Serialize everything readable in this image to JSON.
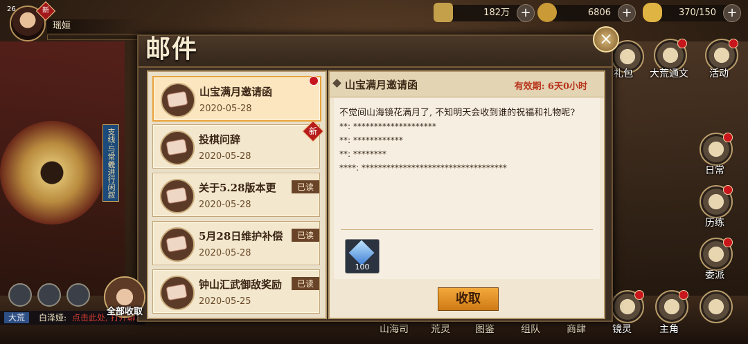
{
  "player": {
    "level": "26",
    "name": "瑶姮",
    "new_tag": "新",
    "exp_fraction": 0.0
  },
  "resources": [
    {
      "icon": "coin-icon",
      "value": "182万"
    },
    {
      "icon": "jade-icon",
      "value": "6806"
    },
    {
      "icon": "stamina-icon",
      "value": "370/150"
    }
  ],
  "side_sign": "支线·与常羲进行闲叙",
  "right_menu": [
    {
      "label": "缘礼包",
      "icon": "gift-pack-icon"
    },
    {
      "label": "大荒通文",
      "icon": "pass-icon"
    },
    {
      "label": "活动",
      "icon": "activity-icon"
    },
    {
      "label": "日常",
      "icon": "daily-icon"
    },
    {
      "label": "历练",
      "icon": "training-icon"
    },
    {
      "label": "委派",
      "icon": "dispatch-icon"
    },
    {
      "label": "镜灵",
      "icon": "mirror-spirit-icon"
    },
    {
      "label": "主角",
      "icon": "hero-icon"
    }
  ],
  "bottom_nav": [
    "山海司",
    "荒灵",
    "图鉴",
    "组队",
    "商肆"
  ],
  "chat": {
    "channel": "大荒",
    "sender": "白泽娅:",
    "message": "点击此处, 打开聊..."
  },
  "quick_new_tag": "新",
  "mail": {
    "title": "邮件",
    "close": "×",
    "items": [
      {
        "title": "山宝满月邀请函",
        "date": "2020-05-28",
        "read": "",
        "badge": "dot"
      },
      {
        "title": "投棋问辞",
        "date": "2020-05-28",
        "read": "",
        "badge": "新"
      },
      {
        "title": "关于5.28版本更",
        "date": "2020-05-28",
        "read": "已读",
        "badge": ""
      },
      {
        "title": "5月28日维护补偿",
        "date": "2020-05-28",
        "read": "已读",
        "badge": ""
      },
      {
        "title": "钟山汇武御敌奖励",
        "date": "2020-05-25",
        "read": "已读",
        "badge": ""
      }
    ],
    "detail": {
      "title": "山宝满月邀请函",
      "expiry": "有效期: 6天0小时",
      "lines": [
        "不觉间山海镜花满月了, 不知明天会收到谁的祝福和礼物呢?",
        "**: ********************",
        "**: ************",
        "**: ********",
        "****: ***********************************"
      ],
      "reward_count": "100",
      "collect_label": "收取"
    },
    "collect_all_label": "全部收取"
  }
}
